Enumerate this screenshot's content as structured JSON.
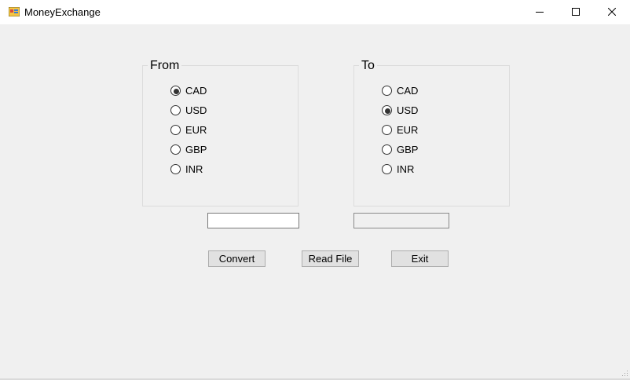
{
  "window": {
    "title": "MoneyExchange",
    "icon": "windows-form-icon",
    "controls": [
      "minimize-icon",
      "maximize-icon",
      "close-icon"
    ]
  },
  "from_group": {
    "title": "From",
    "options": [
      "CAD",
      "USD",
      "EUR",
      "GBP",
      "INR"
    ],
    "selected": "CAD"
  },
  "to_group": {
    "title": "To",
    "options": [
      "CAD",
      "USD",
      "EUR",
      "GBP",
      "INR"
    ],
    "selected": "USD"
  },
  "amount_input": {
    "value": ""
  },
  "result_output": {
    "value": ""
  },
  "buttons": {
    "convert": "Convert",
    "read_file": "Read File",
    "exit": "Exit"
  }
}
